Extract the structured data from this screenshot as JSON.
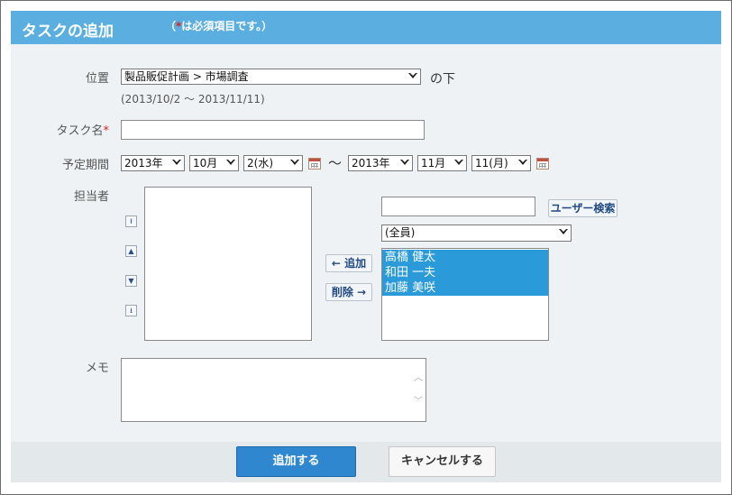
{
  "header": {
    "title": "タスクの追加",
    "note_open": "（",
    "note_star": "*",
    "note_rest": "は必須項目です。）"
  },
  "position": {
    "label": "位置",
    "selected": "製品販促計画 > 市場調査",
    "suffix": "の下",
    "range": "(2013/10/2 ～ 2013/11/11)"
  },
  "task_name": {
    "label": "タスク名",
    "required_mark": "*",
    "value": ""
  },
  "period": {
    "label": "予定期間",
    "start_year": "2013年",
    "start_month": "10月",
    "start_day": "2(水)",
    "separator": "～",
    "end_year": "2013年",
    "end_month": "11月",
    "end_day": "11(月)"
  },
  "assignee": {
    "label": "担当者",
    "order_buttons": [
      "⭱",
      "▲",
      "▼",
      "⭳"
    ],
    "add_label": "← 追加",
    "remove_label": "削除 →",
    "search_value": "",
    "search_button": "ユーザー検索",
    "group_selected": "(全員)",
    "candidates": [
      "高橋 健太",
      "和田 一夫",
      "加藤 美咲"
    ]
  },
  "memo": {
    "label": "メモ",
    "value": ""
  },
  "footer": {
    "submit_label": "追加する",
    "cancel_label": "キャンセルする"
  },
  "colors": {
    "header_bg": "#5aaee0",
    "primary_button": "#2f88cf",
    "selection": "#2b9ad8",
    "required": "#e02020"
  }
}
